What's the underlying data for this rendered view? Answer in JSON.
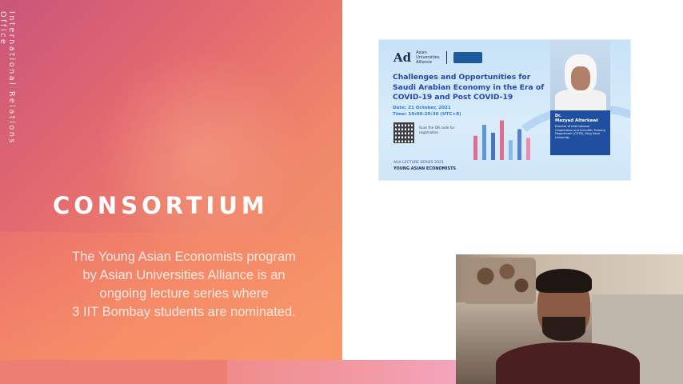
{
  "slide": {
    "side_label": "International Relations Office",
    "heading": "CONSORTIUM",
    "description_lines": [
      "The Young Asian Economists program",
      "by Asian Universities Alliance is an",
      "ongoing lecture series where",
      "3 IIT Bombay students are nominated."
    ]
  },
  "poster": {
    "logo_mark": "Ad",
    "logo_text": "Asian Universities Alliance",
    "title": "Challenges and Opportunities for Saudi Arabian Economy in the Era of COVID-19 and Post COVID-19",
    "date": "Date: 21 October, 2021",
    "time": "Time: 19:00-20:30 (UTC+8)",
    "qr_text": "Scan the QR code for registration",
    "series": "AUA LECTURE SERIES 2021",
    "series_sub": "YOUNG ASIAN ECONOMISTS",
    "speaker_title": "Dr.",
    "speaker_name": "Mezyad Alterkawi",
    "speaker_bio": "Director of International Cooperation and Scientific Training Department (CSTD), King Saud University"
  },
  "colors": {
    "panel_start": "#c9557a",
    "panel_end": "#f39a6a",
    "poster_title": "#2448a8",
    "poster_accent": "#2c7de0",
    "bio_box": "#1f4f9e"
  },
  "bars": {
    "values": [
      0.55,
      0.8,
      0.62,
      0.9,
      0.45,
      0.7,
      0.5
    ],
    "colors": [
      "#e0577a",
      "#4a86d8",
      "#2f5fbf",
      "#e0577a",
      "#7bb1ea",
      "#3d6fcc",
      "#f07aa0"
    ]
  }
}
